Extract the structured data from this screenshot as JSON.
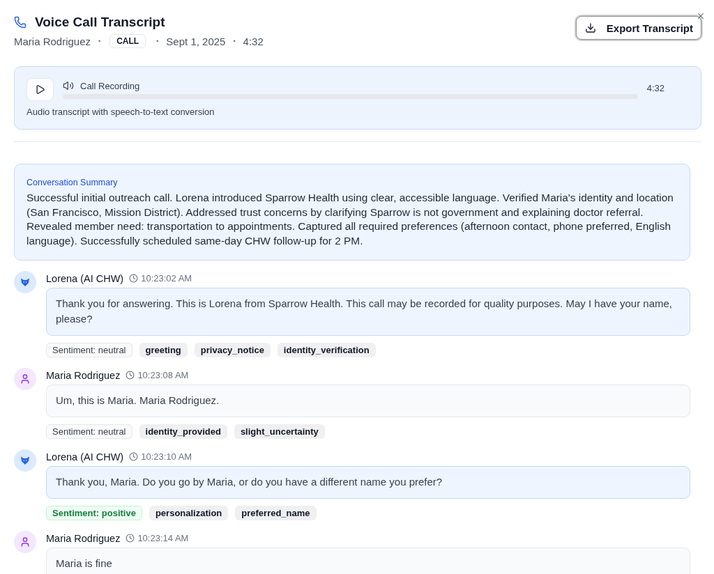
{
  "header": {
    "title": "Voice Call Transcript",
    "meta": [
      {
        "kind": "text",
        "text": "Maria Rodriguez"
      },
      {
        "kind": "separator",
        "text": "•"
      },
      {
        "kind": "badge",
        "text": "CALL"
      },
      {
        "kind": "separator",
        "text": "•"
      },
      {
        "kind": "text",
        "text": "Sept 1, 2025"
      },
      {
        "kind": "separator",
        "text": "•"
      },
      {
        "kind": "text",
        "text": "4:32"
      }
    ],
    "export_button": {
      "label": "Export Transcript",
      "focused": true
    }
  },
  "recording": {
    "title": "Call Recording",
    "duration": "4:32",
    "description": "Audio transcript with speech-to-text conversion",
    "progress": {
      "level": 0
    }
  },
  "summary": {
    "title": "Conversation Summary",
    "text": "Successful initial outreach call. Lorena introduced Sparrow Health using clear, accessible language. Verified Maria's identity and location (San Francisco, Mission District). Addressed trust concerns by clarifying Sparrow is not government and explaining doctor referral. Revealed member need: transportation to appointments. Captured all required preferences (afternoon contact, phone preferred, English language). Successfully scheduled same-day CHW follow-up for 2 PM."
  },
  "messages": [
    {
      "kind": "agent",
      "speaker": "Lorena (AI CHW)",
      "time": "10:23:02 AM",
      "text": "Thank you for answering. This is Lorena from Sparrow Health. This call may be recorded for quality purposes. May I have your name, please?",
      "sentiment": {
        "kind": "neutral",
        "label": "Sentiment: neutral"
      },
      "tags": [
        "greeting",
        "privacy_notice",
        "identity_verification"
      ]
    },
    {
      "kind": "member",
      "speaker": "Maria Rodriguez",
      "time": "10:23:08 AM",
      "text": "Um, this is Maria. Maria Rodriguez.",
      "sentiment": {
        "kind": "neutral",
        "label": "Sentiment: neutral"
      },
      "tags": [
        "identity_provided",
        "slight_uncertainty"
      ]
    },
    {
      "kind": "agent",
      "speaker": "Lorena (AI CHW)",
      "time": "10:23:10 AM",
      "text": "Thank you, Maria. Do you go by Maria, or do you have a different name you prefer?",
      "sentiment": {
        "kind": "positive",
        "label": "Sentiment: positive"
      },
      "tags": [
        "personalization",
        "preferred_name"
      ]
    },
    {
      "kind": "member",
      "speaker": "Maria Rodriguez",
      "time": "10:23:14 AM",
      "text": "Maria is fine"
    }
  ]
}
